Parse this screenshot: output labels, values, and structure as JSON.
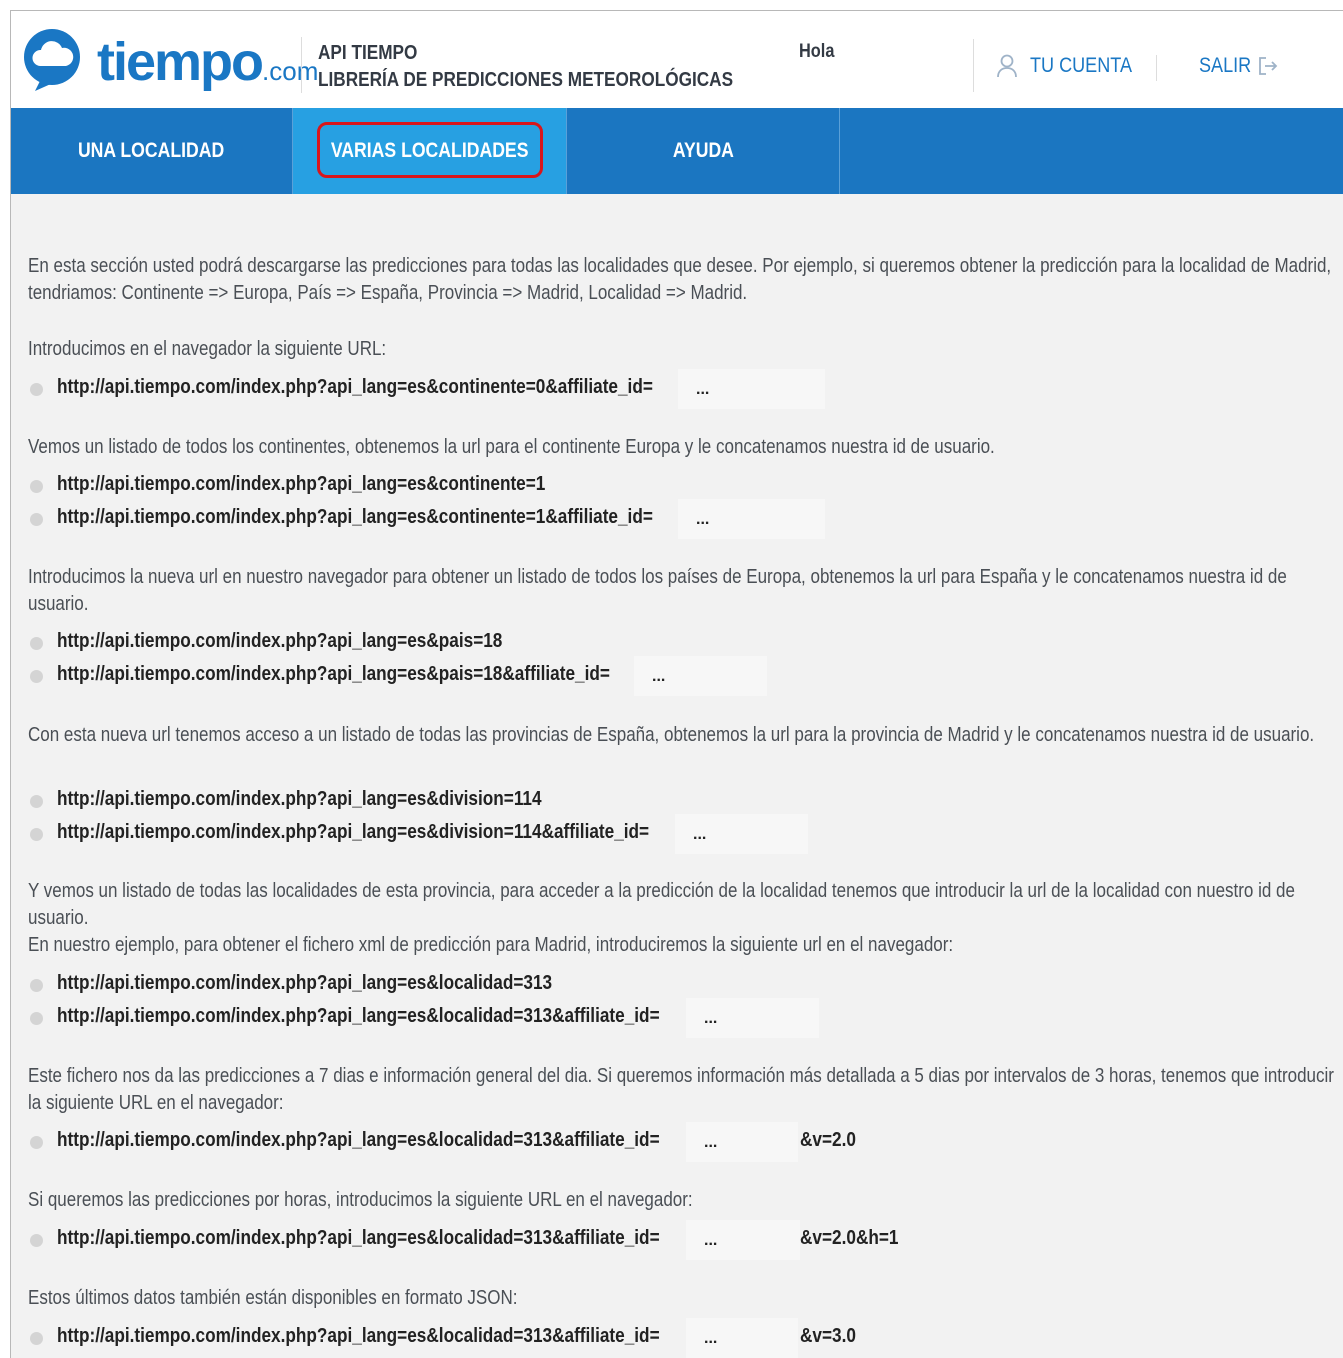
{
  "header": {
    "logo_word": "tiempo",
    "logo_suffix": ".com",
    "api_title_line1": "API TIEMPO",
    "api_title_line2": "LIBRERÍA DE PREDICCIONES METEOROLÓGICAS",
    "greeting": "Hola",
    "account_label": "TU CUENTA",
    "logout_label": "SALIR"
  },
  "nav": {
    "tabs": [
      {
        "label": "UNA LOCALIDAD",
        "active": false
      },
      {
        "label": "VARIAS LOCALIDADES",
        "active": true
      },
      {
        "label": "AYUDA",
        "active": false
      }
    ]
  },
  "content": {
    "intro": "En esta sección usted podrá descargarse las predicciones para todas las localidades que desee. Por ejemplo, si queremos obtener la predicción para la localidad de Madrid, tendriamos: Continente => Europa, País => España, Provincia => Madrid, Localidad => Madrid.",
    "step1_text": "Introducimos en el navegador la siguiente URL:",
    "step1_url": "http://api.tiempo.com/index.php?api_lang=es&continente=0&affiliate_id=",
    "step2_text": "Vemos un listado de todos los continentes, obtenemos la url para el continente Europa y le concatenamos nuestra id de usuario.",
    "step2_url_a": "http://api.tiempo.com/index.php?api_lang=es&continente=1",
    "step2_url_b": "http://api.tiempo.com/index.php?api_lang=es&continente=1&affiliate_id=",
    "step3_text": "Introducimos la nueva url en nuestro navegador para obtener un listado de todos los países de Europa, obtenemos la url para España y le concatenamos nuestra id de usuario.",
    "step3_url_a": "http://api.tiempo.com/index.php?api_lang=es&pais=18",
    "step3_url_b": "http://api.tiempo.com/index.php?api_lang=es&pais=18&affiliate_id=",
    "step4_text": "Con esta nueva url tenemos acceso a un listado de todas las provincias de España, obtenemos la url para la provincia de Madrid y le concatenamos nuestra id de usuario.",
    "step4_url_a": "http://api.tiempo.com/index.php?api_lang=es&division=114",
    "step4_url_b": "http://api.tiempo.com/index.php?api_lang=es&division=114&affiliate_id=",
    "step5_text_a": "Y vemos un listado de todas las localidades de esta provincia, para acceder a la predicción de la localidad tenemos que introducir la url de la localidad con nuestro id de usuario.",
    "step5_text_b": "En nuestro ejemplo, para obtener el fichero xml de predicción para Madrid, introduciremos la siguiente url en el navegador:",
    "step5_url_a": "http://api.tiempo.com/index.php?api_lang=es&localidad=313",
    "step5_url_b": "http://api.tiempo.com/index.php?api_lang=es&localidad=313&affiliate_id=",
    "step6_text": "Este fichero nos da las predicciones a 7 dias e información general del dia. Si queremos información más detallada a 5 dias por intervalos de 3 horas, tenemos que introducir la siguiente URL en el navegador:",
    "step6_url": "http://api.tiempo.com/index.php?api_lang=es&localidad=313&affiliate_id=",
    "step6_suffix": "&v=2.0",
    "step7_text": "Si queremos las predicciones por horas, introducimos la siguiente URL en el navegador:",
    "step7_url": "http://api.tiempo.com/index.php?api_lang=es&localidad=313&affiliate_id=",
    "step7_suffix": "&v=2.0&h=1",
    "step8_text": "Estos últimos datos también están disponibles en formato JSON:",
    "step8_url": "http://api.tiempo.com/index.php?api_lang=es&localidad=313&affiliate_id=",
    "step8_suffix": "&v=3.0",
    "placeholder_dots": "..."
  },
  "colors": {
    "brand_blue": "#1a77c4",
    "nav_blue": "#1b76c1",
    "active_tab": "#27a0e2",
    "highlight_red": "#d9151b",
    "background": "#f2f2f2"
  },
  "icons": [
    "cloud-chat-logo-icon",
    "user-icon",
    "logout-icon"
  ]
}
